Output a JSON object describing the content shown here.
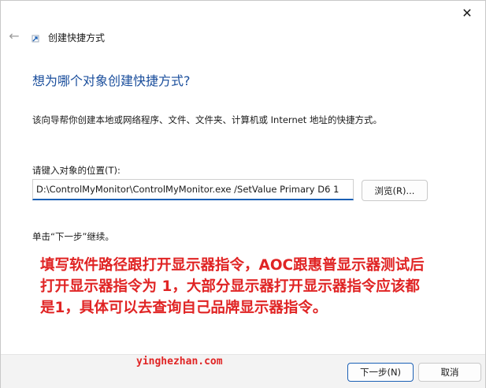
{
  "window": {
    "close_glyph": "✕"
  },
  "wizard": {
    "back_glyph": "←",
    "title": "创建快捷方式",
    "heading": "想为哪个对象创建快捷方式?",
    "description": "该向导帮你创建本地或网络程序、文件、文件夹、计算机或 Internet 地址的快捷方式。",
    "location_label": "请键入对象的位置(T):",
    "location_value": "D:\\ControlMyMonitor\\ControlMyMonitor.exe /SetValue Primary D6 1",
    "browse_label": "浏览(R)...",
    "continue_hint": "单击“下一步”继续。"
  },
  "annotation": {
    "lines": [
      "填写软件路径跟打开显示器指令，AOC跟惠普显示器测试后",
      "打开显示器指令为 1，大部分显示器打开显示器指令应该都",
      "是1，具体可以去查询自己品牌显示器指令。"
    ],
    "color": "#e02424"
  },
  "watermark": "yinghezhan.com",
  "footer": {
    "next_label": "下一步(N)",
    "cancel_label": "取消"
  },
  "colors": {
    "heading": "#1a4e9c",
    "accent": "#1a5fb4"
  }
}
